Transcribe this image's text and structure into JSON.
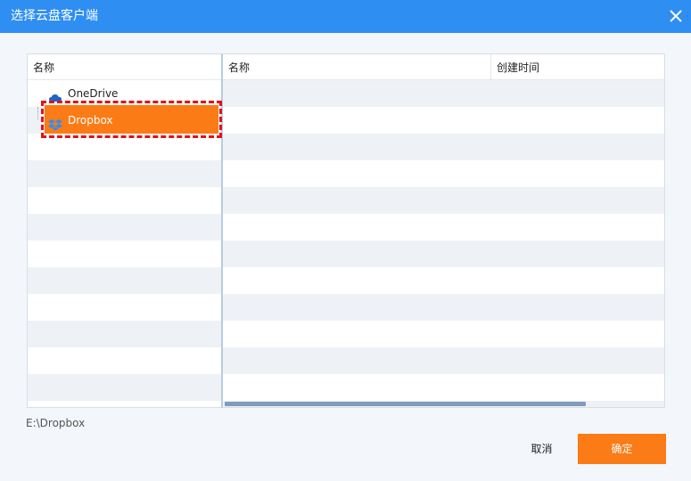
{
  "window": {
    "title": "选择云盘客户端",
    "close_icon": "close-icon"
  },
  "left_panel": {
    "header": "名称",
    "items": [
      {
        "label": "OneDrive",
        "icon": "onedrive-cloud-icon",
        "color": "#1e64c8"
      },
      {
        "label": "Dropbox",
        "icon": "dropbox-icon",
        "color": "#2f8ef2",
        "selected": true
      }
    ]
  },
  "right_panel": {
    "columns": [
      "名称",
      "创建时间"
    ]
  },
  "path": "E:\\Dropbox",
  "buttons": {
    "cancel": "取消",
    "ok": "确定"
  },
  "colors": {
    "titlebar": "#2f8ef2",
    "accent": "#fb7b16",
    "focus": "#e0121b"
  }
}
